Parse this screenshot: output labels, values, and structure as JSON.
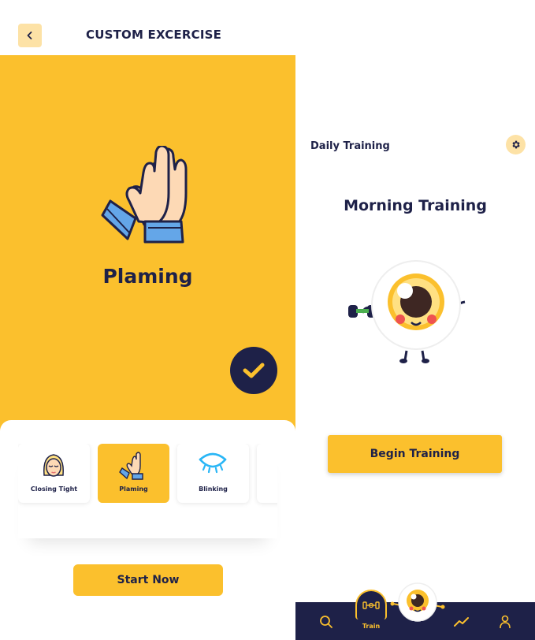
{
  "left_screen": {
    "title": "CUSTOM EXCERCISE",
    "selected_exercise": "Plaming",
    "exercises": [
      {
        "label": "Closing Tight",
        "icon": "face-eyes-closed-icon",
        "active": false
      },
      {
        "label": "Plaming",
        "icon": "palms-icon",
        "active": true
      },
      {
        "label": "Blinking",
        "icon": "eye-blink-icon",
        "active": false
      }
    ],
    "start_label": "Start Now"
  },
  "right_screen": {
    "section_title": "Daily Training",
    "training_title": "Morning Training",
    "begin_label": "Begin Training",
    "nav": {
      "train_label": "Train",
      "items": [
        "search-icon",
        "train-icon",
        "mascot-icon",
        "stats-icon",
        "profile-icon"
      ]
    }
  },
  "colors": {
    "accent": "#FBC02D",
    "accent_light": "#FDE2A6",
    "navy": "#1E2148"
  }
}
